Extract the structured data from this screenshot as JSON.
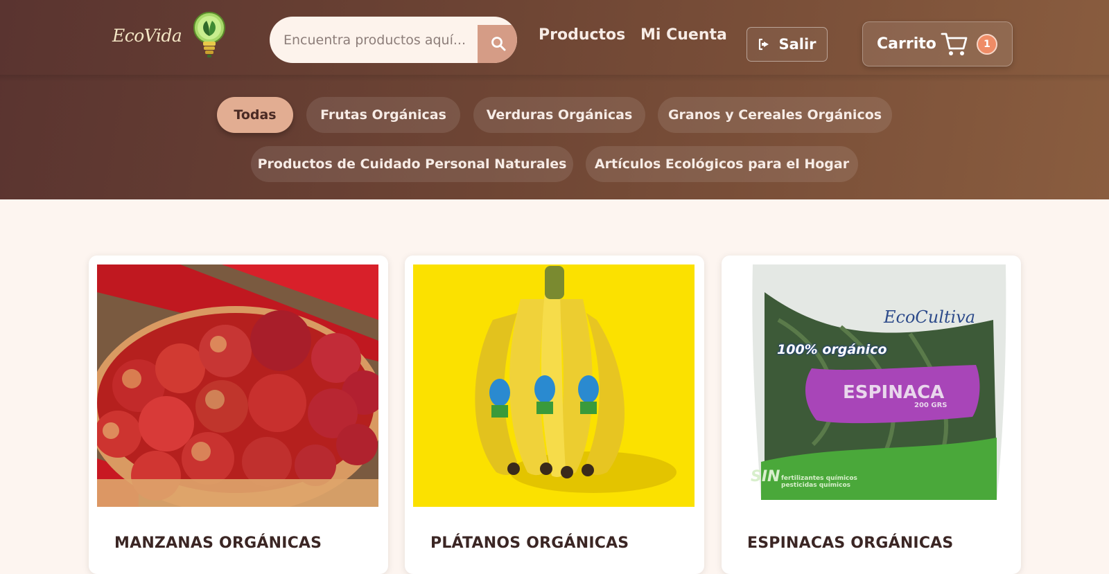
{
  "header": {
    "logo_text": "EcoVida",
    "search": {
      "placeholder": "Encuentra productos aquí..."
    },
    "nav": {
      "productos": "Productos",
      "mi_cuenta": "Mi Cuenta"
    },
    "logout_label": "Salir",
    "cart": {
      "label": "Carrito",
      "count": "1"
    }
  },
  "categories": {
    "todas": "Todas",
    "frutas": "Frutas Orgánicas",
    "verduras": "Verduras Orgánicas",
    "granos": "Granos y Cereales Orgánicos",
    "cuidado": "Productos de Cuidado Personal Naturales",
    "hogar": "Artículos Ecológicos para el Hogar",
    "active": "Todas"
  },
  "products": [
    {
      "title": "MANZANAS ORGÁNICAS",
      "image": "apples-in-basket-photo"
    },
    {
      "title": "PLÁTANOS ORGÁNICAS",
      "image": "banana-bunch-photo"
    },
    {
      "title": "ESPINACAS ORGÁNICAS",
      "image": "spinach-bag-photo",
      "package": {
        "brand": "EcoCultiva",
        "badge": "100% orgánico",
        "label": "ESPINACA",
        "weight": "200 GRS",
        "footer_big": "SIN",
        "footer_small": "fertilizantes químicos pesticidas químicos"
      }
    }
  ],
  "colors": {
    "header_start": "#5a3430",
    "header_end": "#8a5d3f",
    "accent": "#e2ad92",
    "search_button": "#d59c86",
    "badge": "#ef8c66",
    "page_bg": "#fdf5f0"
  }
}
